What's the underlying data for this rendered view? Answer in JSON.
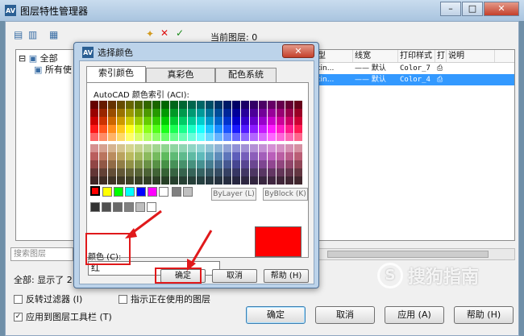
{
  "window": {
    "title": "图层特性管理器",
    "app_icon_text": "AV",
    "current_layer_label": "当前图层: 0"
  },
  "toolbar": {
    "new_icon": "new-layer-icon",
    "delete_icon": "delete-icon",
    "set_current_icon": "check-icon"
  },
  "tree": {
    "all": "全部",
    "used": "所有使"
  },
  "grid": {
    "headers": [
      "型",
      "线宽",
      "打印样式",
      "打",
      "说明"
    ],
    "rows": [
      {
        "linetype": "tin...",
        "lineweight": "—— 默认",
        "plotstyle": "Color_7",
        "selected": false
      },
      {
        "linetype": "tin...",
        "lineweight": "—— 默认",
        "plotstyle": "Color_4",
        "selected": true
      }
    ]
  },
  "search": {
    "placeholder": "搜索图层"
  },
  "status": {
    "text": "全部: 显示了 2"
  },
  "options": {
    "invert_filter": "反转过滤器 (I)",
    "indicate_used": "指示正在使用的图层",
    "apply_toolbar": "应用到图层工具栏 (T)"
  },
  "main_buttons": {
    "ok": "确定",
    "cancel": "取消",
    "apply": "应用 (A)",
    "help": "帮助 (H)"
  },
  "dialog": {
    "title": "选择颜色",
    "tabs": [
      "索引颜色",
      "真彩色",
      "配色系统"
    ],
    "aci_label": "AutoCAD 颜色索引 (ACI):",
    "bylayer": "ByLayer (L)",
    "byblock": "ByBlock (K)",
    "color_label": "颜色 (C):",
    "color_value": "红",
    "ok": "确定",
    "cancel": "取消",
    "help": "帮助 (H)",
    "preview_color": "#ff0000"
  },
  "watermark": {
    "text": "搜狗指南"
  }
}
